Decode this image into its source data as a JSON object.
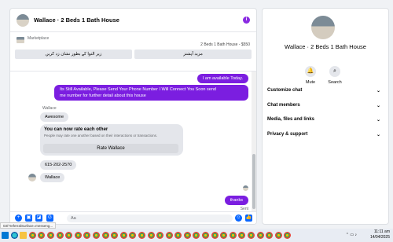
{
  "chat": {
    "title": "Wallace · 2 Beds 1 Bath House",
    "marketplace_label": "Marketplace",
    "listing_summary": "2 Beds 1 Bath House - $550",
    "quick_replies": [
      "مزید آپشنز",
      "زیر التوا کے بطور نشان زد کریں"
    ],
    "messages": {
      "out_1": "I am available Today.",
      "out_2_line1": "Its Still Available, Please Send Your Phone Number I Will Connect You Soon      send",
      "out_2_line2": "me number for further detail about this house",
      "sender_name": "Wallace",
      "in_1": "Awesome",
      "rate_title": "You can now rate each other",
      "rate_sub": "People may rate one another based on their interactions or transactions.",
      "rate_button": "Rate Wallace",
      "in_2": "615-202-2570",
      "in_3": "Wallace",
      "out_3": "thanks",
      "status": "Sent"
    },
    "composer_placeholder": "Aa"
  },
  "info": {
    "title": "Wallace · 2 Beds 1 Bath House",
    "mute_label": "Mute",
    "search_label": "Search",
    "sections": [
      "Customize chat",
      "Chat members",
      "Media, files and links",
      "Privacy & support"
    ]
  },
  "status_url": "03/?referralSurface=messeng...",
  "clock": {
    "time": "11:11 am",
    "date": "14/04/2025"
  }
}
